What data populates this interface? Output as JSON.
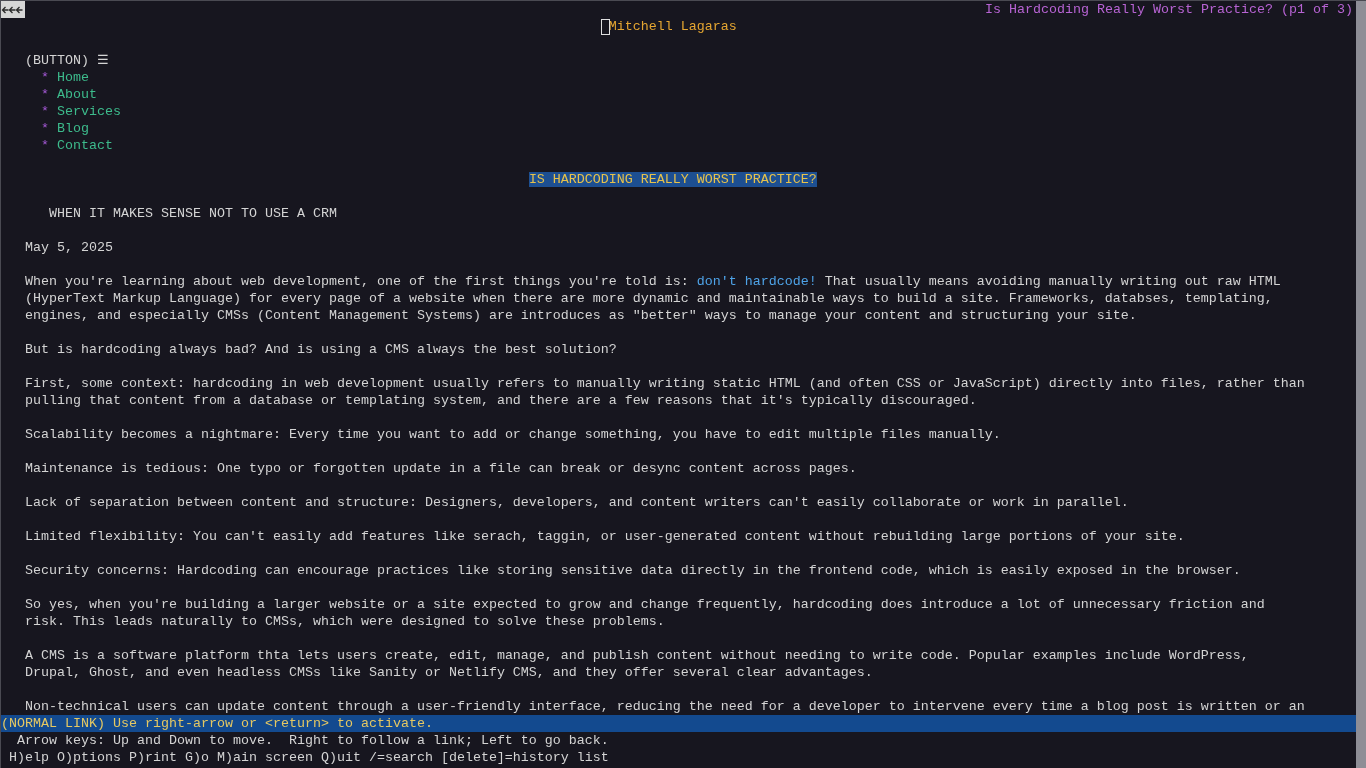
{
  "title_bar": {
    "page_title": "Is Hardcoding Really Worst Practice? (p1 of 3)"
  },
  "site_name": "Mitchell Lagaras",
  "menu_button": {
    "label": "(BUTTON) ☰"
  },
  "nav": [
    {
      "marker": "*",
      "label": "Home",
      "selected": false
    },
    {
      "marker": "*",
      "label": "About",
      "selected": false
    },
    {
      "marker": "*",
      "label": "Services",
      "selected": false
    },
    {
      "marker": "*",
      "label": "Blog",
      "selected": false
    },
    {
      "marker": "*",
      "label": "Contact",
      "selected": false
    }
  ],
  "article": {
    "title": {
      "text": "IS HARDCODING REALLY WORST PRACTICE?",
      "selected": true
    },
    "subtitle": "WHEN IT MAKES SENSE NOT TO USE A CRM",
    "date": "May 5, 2025",
    "paragraphs": [
      [
        {
          "kind": "text",
          "text": "When you're learning about web development, one of the first things you're told is: "
        },
        {
          "kind": "link",
          "text": "don't hardcode!",
          "selected": false
        },
        {
          "kind": "text",
          "text": " That usually means avoiding manually writing out raw HTML\n(HyperText Markup Language) for every page of a website when there are more dynamic and maintainable ways to build a site. Frameworks, databses, templating,\nengines, and especially CMSs (Content Management Systems) are introduces as \"better\" ways to manage your content and structuring your site."
        }
      ],
      [
        {
          "kind": "text",
          "text": "But is hardcoding always bad? And is using a CMS always the best solution?"
        }
      ],
      [
        {
          "kind": "text",
          "text": "First, some context: hardcoding in web development usually refers to manually writing static HTML (and often CSS or JavaScript) directly into files, rather than\npulling that content from a database or templating system, and there are a few reasons that it's typically discouraged."
        }
      ],
      [
        {
          "kind": "text",
          "text": "Scalability becomes a nightmare: Every time you want to add or change something, you have to edit multiple files manually."
        }
      ],
      [
        {
          "kind": "text",
          "text": "Maintenance is tedious: One typo or forgotten update in a file can break or desync content across pages."
        }
      ],
      [
        {
          "kind": "text",
          "text": "Lack of separation between content and structure: Designers, developers, and content writers can't easily collaborate or work in parallel."
        }
      ],
      [
        {
          "kind": "text",
          "text": "Limited flexibility: You can't easily add features like serach, taggin, or user-generated content without rebuilding large portions of your site."
        }
      ],
      [
        {
          "kind": "text",
          "text": "Security concerns: Hardcoding can encourage practices like storing sensitive data directly in the frontend code, which is easily exposed in the browser."
        }
      ],
      [
        {
          "kind": "text",
          "text": "So yes, when you're building a larger website or a site expected to grow and change frequently, hardcoding does introduce a lot of unnecessary friction and\nrisk. This leads naturally to CMSs, which were designed to solve these problems."
        }
      ],
      [
        {
          "kind": "text",
          "text": "A CMS is a software platform thta lets users create, edit, manage, and publish content without needing to write code. Popular examples include WordPress,\nDrupal, Ghost, and even headless CMSs like Sanity or Netlify CMS, and they offer several clear advantages."
        }
      ],
      [
        {
          "kind": "text",
          "text": "Non-technical users can update content through a user-friendly interface, reducing the need for a developer to intervene every time a blog post is written or an"
        }
      ]
    ]
  },
  "status_bar": {
    "message": "(NORMAL LINK) Use right-arrow or <return> to activate.",
    "hints": [
      "Arrow keys: Up and Down to move.  Right to follow a link; Left to go back.",
      "H)elp O)ptions P)rint G)o M)ain screen Q)uit /=search [delete]=history list"
    ]
  }
}
